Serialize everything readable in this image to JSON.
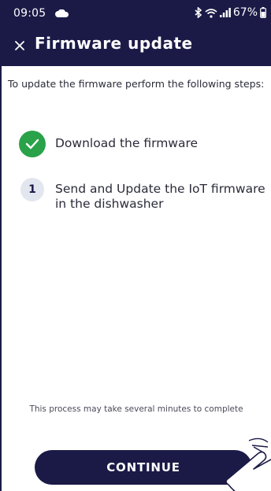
{
  "status_bar": {
    "time": "09:05",
    "battery": "67%",
    "icons": [
      "cloud-icon",
      "bluetooth-icon",
      "wifi-icon",
      "signal-icon",
      "battery-icon"
    ]
  },
  "header": {
    "title": "Firmware update",
    "close_icon": "close-icon"
  },
  "main": {
    "intro": "To update the firmware perform the following steps:",
    "steps": [
      {
        "status": "done",
        "icon": "check-icon",
        "label": "Download the firmware"
      },
      {
        "status": "pending",
        "number": "1",
        "label": "Send and Update the IoT firmware in the dishwasher"
      }
    ],
    "note": "This process may take several minutes to complete"
  },
  "footer": {
    "continue_label": "CONTINUE"
  },
  "colors": {
    "brand_navy": "#1b1a47",
    "success_green": "#2aa24a",
    "step_badge": "#e2e6ef"
  }
}
